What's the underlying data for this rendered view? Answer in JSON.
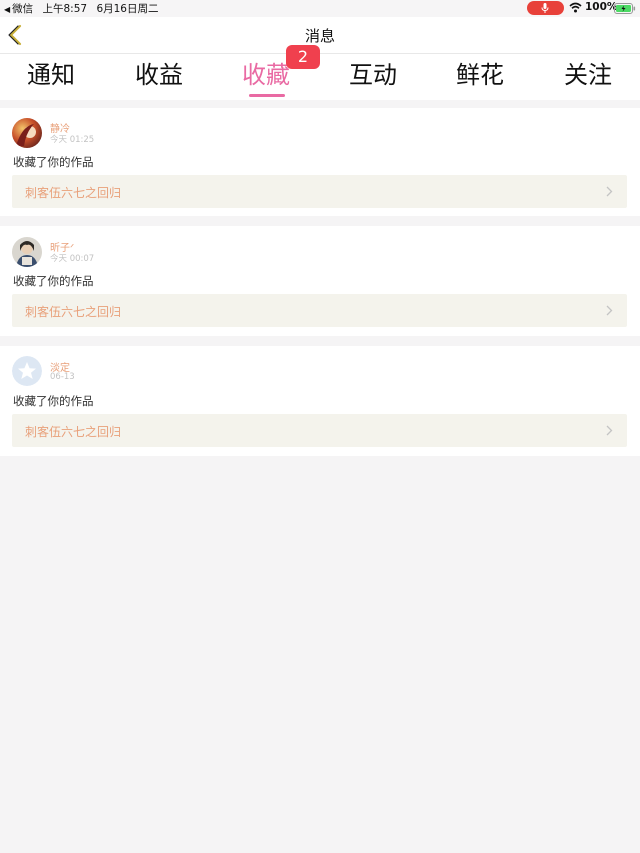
{
  "status_bar": {
    "back_app": "微信",
    "time": "上午8:57",
    "date": "6月16日周二",
    "battery": "100%"
  },
  "nav": {
    "title": "消息"
  },
  "tabs": {
    "items": [
      {
        "label": "通知",
        "active": false
      },
      {
        "label": "收益",
        "active": false
      },
      {
        "label": "收藏",
        "active": true
      },
      {
        "label": "互动",
        "active": false
      },
      {
        "label": "鲜花",
        "active": false
      },
      {
        "label": "关注",
        "active": false
      }
    ],
    "badge": "2"
  },
  "messages": [
    {
      "user": "静冷",
      "time": "今天 01:25",
      "action": "收藏了你的作品",
      "work": "刺客伍六七之回归"
    },
    {
      "user": "昕子ᐟ",
      "time": "今天 00:07",
      "action": "收藏了你的作品",
      "work": "刺客伍六七之回归"
    },
    {
      "user": "淡定",
      "time": "06-13",
      "action": "收藏了你的作品",
      "work": "刺客伍六七之回归"
    }
  ],
  "colors": {
    "accent_pink": "#e96aa3",
    "badge_red": "#f0404e",
    "name_orange": "#e8a07a",
    "link_bg": "#f4f3ec"
  }
}
